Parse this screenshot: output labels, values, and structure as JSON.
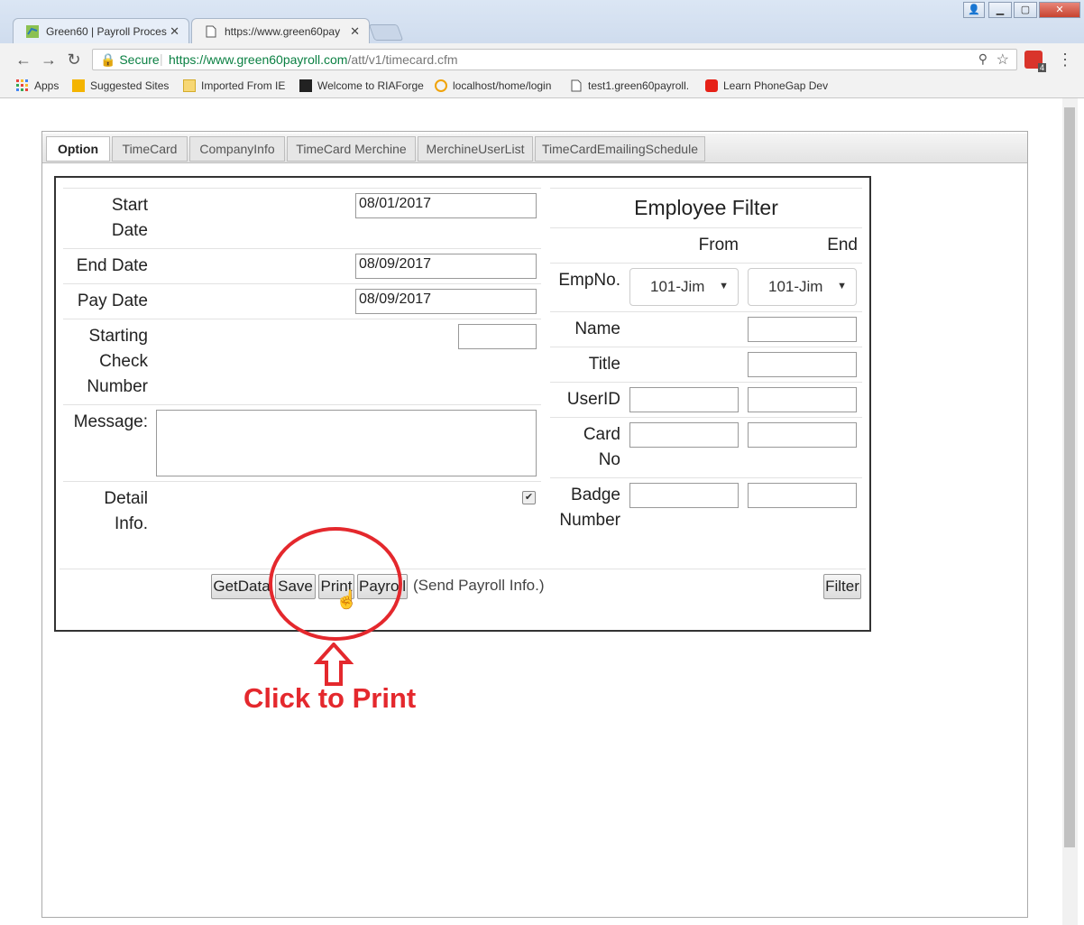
{
  "browser": {
    "tabs": [
      {
        "title": "Green60 | Payroll Proces"
      },
      {
        "title": "https://www.green60pay"
      }
    ],
    "secure_label": "Secure",
    "url_host": "https://www.green60payroll.com",
    "url_path": "/att/v1/timecard.cfm",
    "bookmarks": [
      {
        "label": "Apps",
        "icon": "apps-grid-icon"
      },
      {
        "label": "Suggested Sites",
        "icon": "bing-icon"
      },
      {
        "label": "Imported From IE",
        "icon": "folder-icon"
      },
      {
        "label": "Welcome to RIAForge",
        "icon": "riaforge-icon"
      },
      {
        "label": "localhost/home/login",
        "icon": "localhost-icon"
      },
      {
        "label": "test1.green60payroll.",
        "icon": "page-icon"
      },
      {
        "label": "Learn PhoneGap Dev",
        "icon": "youtube-icon"
      }
    ],
    "extension_badge": "4"
  },
  "page_tabs": [
    "Option",
    "TimeCard",
    "CompanyInfo",
    "TimeCard Merchine",
    "MerchineUserList",
    "TimeCardEmailingSchedule"
  ],
  "form": {
    "start_date_label_1": "Start",
    "start_date_label_2": "Date",
    "start_date_value": "08/01/2017",
    "end_date_label": "End Date",
    "end_date_value": "08/09/2017",
    "pay_date_label": "Pay Date",
    "pay_date_value": "08/09/2017",
    "check_label_1": "Starting",
    "check_label_2": "Check",
    "check_label_3": "Number",
    "check_value": "",
    "message_label": "Message:",
    "message_value": "",
    "detail_label_1": "Detail",
    "detail_label_2": "Info.",
    "detail_checked": true
  },
  "filter": {
    "title": "Employee Filter",
    "from_label": "From",
    "end_label": "End",
    "empno_label": "EmpNo.",
    "empno_from": "101-Jim",
    "empno_end": "101-Jim",
    "name_label": "Name",
    "title_label": "Title",
    "userid_label": "UserID",
    "card_label_1": "Card",
    "card_label_2": "No",
    "badge_label_1": "Badge",
    "badge_label_2": "Number"
  },
  "actions": {
    "getdata": "GetData",
    "save": "Save",
    "print": "Print",
    "payroll": "Payroll",
    "payroll_note": "(Send Payroll Info.)",
    "filter": "Filter"
  },
  "annotation": {
    "text": "Click to Print",
    "color": "#e4282d"
  }
}
